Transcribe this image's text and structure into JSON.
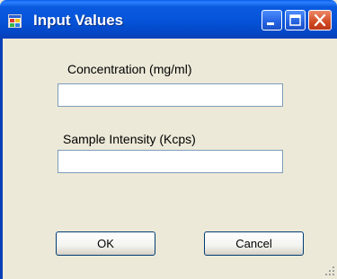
{
  "window": {
    "title": "Input Values",
    "accent": "#0553d8",
    "close_color": "#d24a22"
  },
  "title_buttons": {
    "minimize_icon": "minimize-icon",
    "maximize_icon": "maximize-icon",
    "close_icon": "close-icon"
  },
  "form": {
    "concentration_label": "Concentration (mg/ml)",
    "concentration_value": "",
    "intensity_label": "Sample Intensity (Kcps)",
    "intensity_value": ""
  },
  "buttons": {
    "ok": "OK",
    "cancel": "Cancel"
  }
}
